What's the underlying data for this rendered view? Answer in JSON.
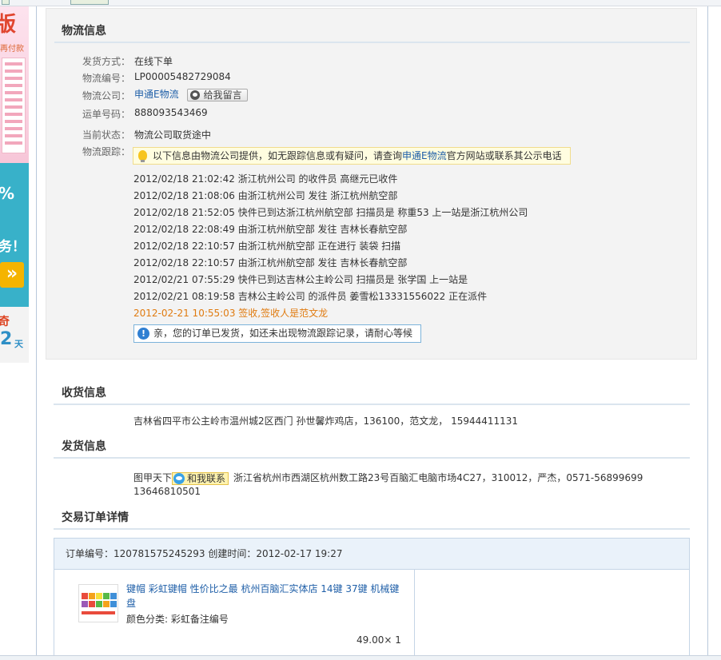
{
  "logistics": {
    "title": "物流信息",
    "fields": {
      "ship_method": {
        "label": "发货方式：",
        "value": "在线下单"
      },
      "logistics_no": {
        "label": "物流编号：",
        "value": "LP00005482729084"
      },
      "company": {
        "label": "物流公司：",
        "value": "申通E物流",
        "msg_button": "给我留言"
      },
      "waybill": {
        "label": "运单号码：",
        "value": "888093543469"
      },
      "status": {
        "label": "当前状态：",
        "value": "物流公司取货途中"
      },
      "tracking": {
        "label": "物流跟踪："
      }
    },
    "tip": {
      "prefix": "以下信息由物流公司提供，如无跟踪信息或有疑问，请查询",
      "link": "申通E物流",
      "suffix": "官方网站或联系其公示电话"
    },
    "events": [
      "2012/02/18 21:02:42 浙江杭州公司 的收件员 高继元已收件",
      "2012/02/18 21:08:06 由浙江杭州公司 发往 浙江杭州航空部",
      "2012/02/18 21:52:05 快件已到达浙江杭州航空部 扫描员是 称重53 上一站是浙江杭州公司",
      "2012/02/18 22:08:49 由浙江杭州航空部 发往 吉林长春航空部",
      "2012/02/18 22:10:57 由浙江杭州航空部 正在进行 装袋 扫描",
      "2012/02/18 22:10:57 由浙江杭州航空部 发往 吉林长春航空部",
      "2012/02/21 07:55:29 快件已到达吉林公主岭公司 扫描员是 张学国 上一站是",
      "2012/02/21 08:19:58 吉林公主岭公司 的派件员 姜雪松13331556022 正在派件",
      "2012-02-21 10:55:03 签收,签收人是范文龙"
    ],
    "notice": "亲，您的订单已发货，如还未出现物流跟踪记录，请耐心等候"
  },
  "receive": {
    "title": "收货信息",
    "address": "吉林省四平市公主岭市温州城2区西门 孙世馨炸鸡店，136100，范文龙，   15944411131"
  },
  "ship": {
    "title": "发货信息",
    "sender": "图甲天下",
    "contact_button": "和我联系",
    "address": "浙江省杭州市西湖区杭州数工路23号百脑汇电脑市场4C27，310012，严杰，0571-56899699",
    "phone": "13646810501"
  },
  "order": {
    "title": "交易订单详情",
    "header": "订单编号：120781575245293   创建时间：2012-02-17 19:27",
    "item": {
      "title": "键帽 彩虹键帽 性价比之最 杭州百脑汇实体店 14键 37键 机械键盘",
      "sku": "颜色分类: 彩虹备注编号",
      "price_qty": "49.00× 1"
    }
  },
  "left_ad": {
    "top": "版",
    "small": "再付款",
    "pct": "%",
    "wu": "务！",
    "arrow": "»",
    "red": "奇",
    "num": "2",
    "unit": "天"
  }
}
